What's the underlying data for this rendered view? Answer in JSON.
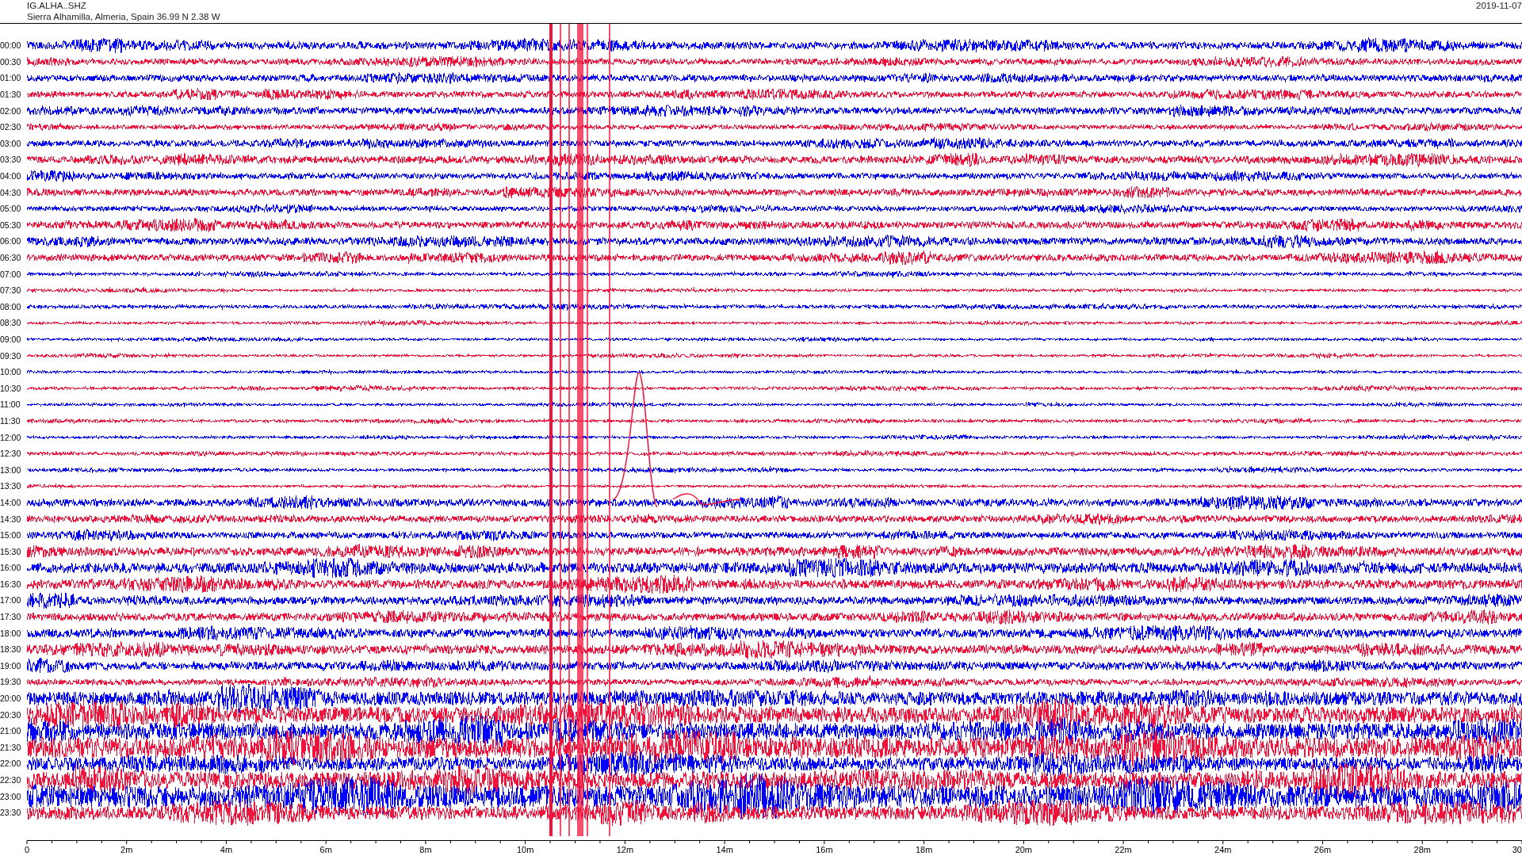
{
  "header": {
    "channel": "IG.ALHA..SHZ",
    "location": "Sierra Alhamilla, Almeria, Spain  36.99 N 2.38 W",
    "date": "2019-11-07"
  },
  "rows": [
    {
      "time": "00:00",
      "color": "#0000ff"
    },
    {
      "time": "00:30",
      "color": "#f0143c"
    },
    {
      "time": "01:00",
      "color": "#0000ff"
    },
    {
      "time": "01:30",
      "color": "#f0143c"
    },
    {
      "time": "02:00",
      "color": "#0000ff"
    },
    {
      "time": "02:30",
      "color": "#f0143c"
    },
    {
      "time": "03:00",
      "color": "#0000ff"
    },
    {
      "time": "03:30",
      "color": "#f0143c"
    },
    {
      "time": "04:00",
      "color": "#0000ff"
    },
    {
      "time": "04:30",
      "color": "#f0143c"
    },
    {
      "time": "05:00",
      "color": "#0000ff"
    },
    {
      "time": "05:30",
      "color": "#f0143c"
    },
    {
      "time": "06:00",
      "color": "#0000ff"
    },
    {
      "time": "06:30",
      "color": "#f0143c"
    },
    {
      "time": "07:00",
      "color": "#0000ff"
    },
    {
      "time": "07:30",
      "color": "#f0143c"
    },
    {
      "time": "08:00",
      "color": "#0000ff"
    },
    {
      "time": "08:30",
      "color": "#f0143c"
    },
    {
      "time": "09:00",
      "color": "#0000ff"
    },
    {
      "time": "09:30",
      "color": "#f0143c"
    },
    {
      "time": "10:00",
      "color": "#0000ff"
    },
    {
      "time": "10:30",
      "color": "#f0143c"
    },
    {
      "time": "11:00",
      "color": "#0000ff"
    },
    {
      "time": "11:30",
      "color": "#f0143c"
    },
    {
      "time": "12:00",
      "color": "#0000ff"
    },
    {
      "time": "12:30",
      "color": "#f0143c"
    },
    {
      "time": "13:00",
      "color": "#0000ff"
    },
    {
      "time": "13:30",
      "color": "#f0143c"
    },
    {
      "time": "14:00",
      "color": "#0000ff"
    },
    {
      "time": "14:30",
      "color": "#f0143c"
    },
    {
      "time": "15:00",
      "color": "#0000ff"
    },
    {
      "time": "15:30",
      "color": "#f0143c"
    },
    {
      "time": "16:00",
      "color": "#0000ff"
    },
    {
      "time": "16:30",
      "color": "#f0143c"
    },
    {
      "time": "17:00",
      "color": "#0000ff"
    },
    {
      "time": "17:30",
      "color": "#f0143c"
    },
    {
      "time": "18:00",
      "color": "#0000ff"
    },
    {
      "time": "18:30",
      "color": "#f0143c"
    },
    {
      "time": "19:00",
      "color": "#0000ff"
    },
    {
      "time": "19:30",
      "color": "#f0143c"
    },
    {
      "time": "20:00",
      "color": "#0000ff"
    },
    {
      "time": "20:30",
      "color": "#f0143c"
    },
    {
      "time": "21:00",
      "color": "#0000ff"
    },
    {
      "time": "21:30",
      "color": "#f0143c"
    },
    {
      "time": "22:00",
      "color": "#0000ff"
    },
    {
      "time": "22:30",
      "color": "#f0143c"
    },
    {
      "time": "23:00",
      "color": "#0000ff"
    },
    {
      "time": "23:30",
      "color": "#f0143c"
    }
  ],
  "axis": {
    "tick_labels": [
      "0",
      "2m",
      "4m",
      "6m",
      "8m",
      "10m",
      "12m",
      "14m",
      "16m",
      "18m",
      "20m",
      "22m",
      "24m",
      "26m",
      "28m",
      "30"
    ]
  }
}
